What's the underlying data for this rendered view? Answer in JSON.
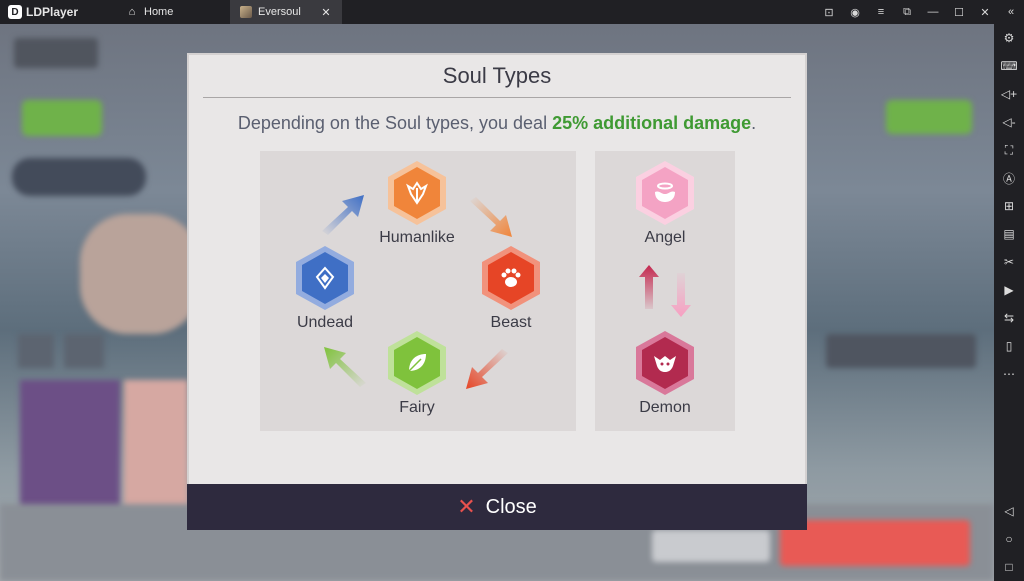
{
  "emulator": {
    "brand": "LDPlayer",
    "tabs": [
      {
        "label": "Home"
      },
      {
        "label": "Eversoul"
      }
    ]
  },
  "modal": {
    "title": "Soul Types",
    "description_prefix": "Depending on the Soul types, you deal ",
    "description_highlight": "25% additional damage",
    "description_suffix": ".",
    "cycle": [
      {
        "label": "Humanlike",
        "icon": "humanlike-icon",
        "color": "#f0853a"
      },
      {
        "label": "Beast",
        "icon": "beast-paw-icon",
        "color": "#e64526"
      },
      {
        "label": "Fairy",
        "icon": "fairy-leaf-icon",
        "color": "#7fc23c"
      },
      {
        "label": "Undead",
        "icon": "undead-icon",
        "color": "#3f6fc5"
      }
    ],
    "pair": [
      {
        "label": "Angel",
        "icon": "angel-icon",
        "color": "#f4a3c4"
      },
      {
        "label": "Demon",
        "icon": "demon-icon",
        "color": "#b22a4f"
      }
    ],
    "close_label": "Close"
  }
}
